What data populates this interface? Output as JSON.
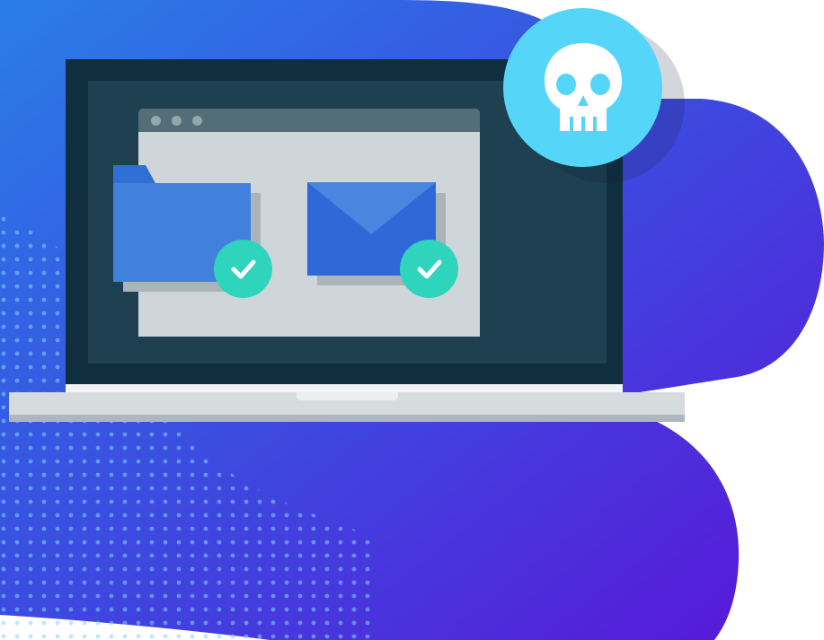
{
  "illustration": {
    "subject": "laptop-with-malware-warning",
    "icons": [
      "folder-icon",
      "envelope-icon",
      "checkmark-icon",
      "checkmark-icon",
      "skull-icon"
    ],
    "status": {
      "folder_check": "ok",
      "envelope_check": "ok",
      "threat": "skull"
    }
  },
  "colors": {
    "background_gradient_start": "#2a7de8",
    "background_gradient_end": "#5a14d8",
    "laptop_frame": "#0f2f3e",
    "laptop_screen": "#1e4050",
    "window_body": "#cfd6da",
    "window_titlebar": "#546e78",
    "folder": "#4180dc",
    "envelope": "#2f69d8",
    "check_badge": "#2fd4bd",
    "skull_badge": "#55d6f8"
  }
}
